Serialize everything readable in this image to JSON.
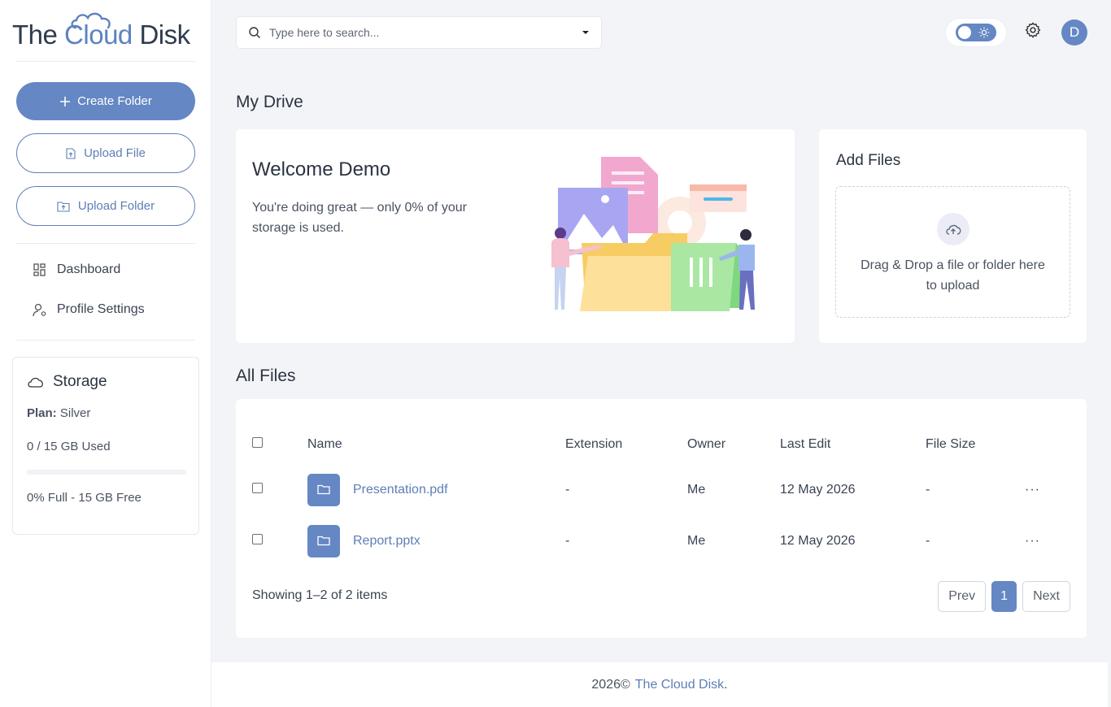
{
  "brand": {
    "part1": "The",
    "part2": "Cloud",
    "part3": "Disk",
    "accent": "#6587c3"
  },
  "sidebar": {
    "create_folder": "Create Folder",
    "upload_file": "Upload File",
    "upload_folder": "Upload Folder",
    "nav": [
      {
        "label": "Dashboard",
        "icon": "dashboard-icon"
      },
      {
        "label": "Profile Settings",
        "icon": "user-settings-icon"
      }
    ],
    "storage": {
      "title": "Storage",
      "plan_label": "Plan:",
      "plan_value": "Silver",
      "used": "0 / 15 GB Used",
      "usage_fraction": 0,
      "summary": "0% Full - 15 GB Free"
    }
  },
  "header": {
    "search_placeholder": "Type here to search...",
    "avatar_initial": "D"
  },
  "main": {
    "section_title": "My Drive",
    "welcome": {
      "title": "Welcome Demo",
      "text": "You're doing great — only 0% of your storage is used."
    },
    "add_files": {
      "title": "Add Files",
      "dropzone_text": "Drag & Drop a file or folder here to upload"
    },
    "all_files": {
      "title": "All Files",
      "columns": [
        "Name",
        "Extension",
        "Owner",
        "Last Edit",
        "File Size"
      ],
      "rows": [
        {
          "name": "Presentation.pdf",
          "extension": "-",
          "owner": "Me",
          "last_edit": "12 May 2026",
          "size": "-"
        },
        {
          "name": "Report.pptx",
          "extension": "-",
          "owner": "Me",
          "last_edit": "12 May 2026",
          "size": "-"
        }
      ],
      "row_menu": "···",
      "showing": "Showing 1–2 of 2 items",
      "pagination": {
        "prev": "Prev",
        "current": "1",
        "next": "Next"
      }
    }
  },
  "footer": {
    "year": "2026©",
    "brand": "The Cloud Disk",
    "suffix": "."
  }
}
